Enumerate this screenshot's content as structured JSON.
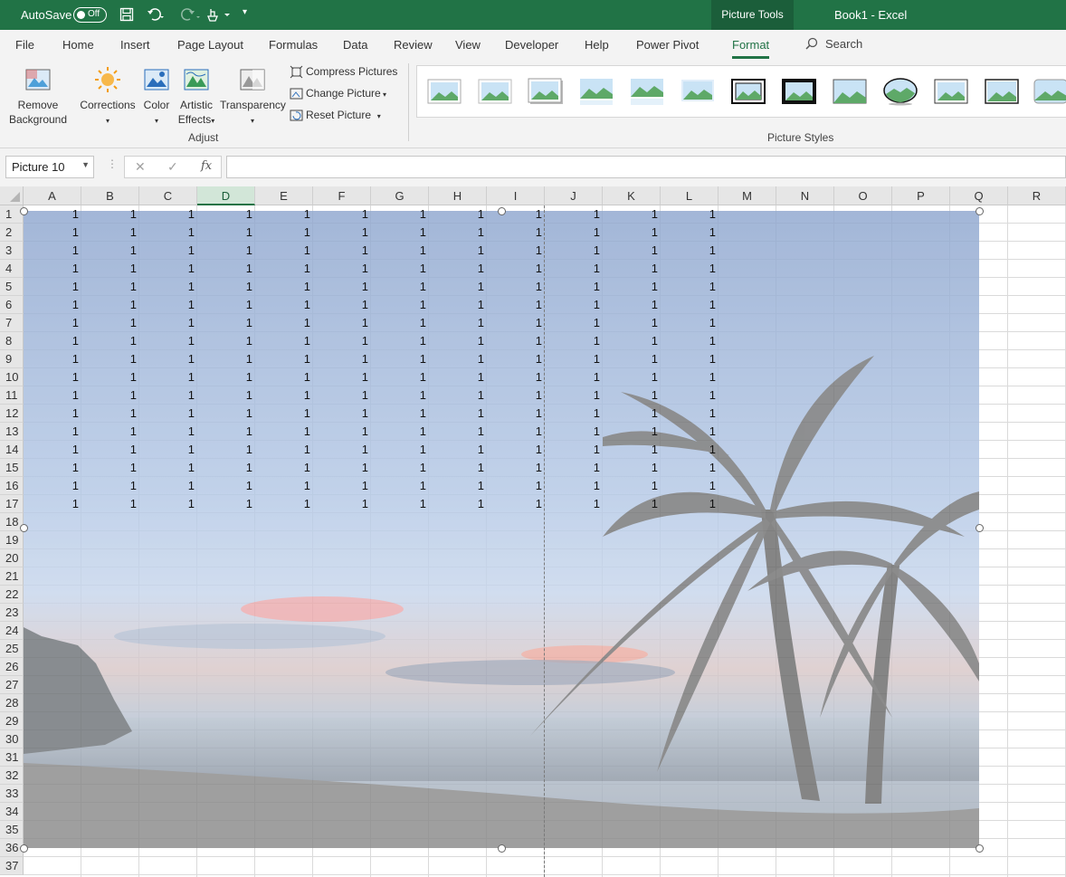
{
  "titlebar": {
    "autosave_label": "AutoSave",
    "autosave_state": "Off",
    "context_tab": "Picture Tools",
    "doc_title": "Book1  -  Excel"
  },
  "tabs": [
    "File",
    "Home",
    "Insert",
    "Page Layout",
    "Formulas",
    "Data",
    "Review",
    "View",
    "Developer",
    "Help",
    "Power Pivot",
    "Format"
  ],
  "active_tab": "Format",
  "search_label": "Search",
  "ribbon": {
    "remove_bg": [
      "Remove",
      "Background"
    ],
    "corrections": "Corrections",
    "color": "Color",
    "artistic": [
      "Artistic",
      "Effects"
    ],
    "transparency": "Transparency",
    "compress": "Compress Pictures",
    "change": "Change Picture",
    "reset": "Reset Picture",
    "adjust_group": "Adjust",
    "styles_group": "Picture Styles"
  },
  "formula_bar": {
    "name_box": "Picture 10",
    "cancel": "✕",
    "enter": "✓",
    "fx": "fx",
    "content": ""
  },
  "grid": {
    "columns": [
      "A",
      "B",
      "C",
      "D",
      "E",
      "F",
      "G",
      "H",
      "I",
      "J",
      "K",
      "L",
      "M",
      "N",
      "O",
      "P",
      "Q",
      "R"
    ],
    "selected_column": "D",
    "rows": [
      1,
      2,
      3,
      4,
      5,
      6,
      7,
      8,
      9,
      10,
      11,
      12,
      13,
      14,
      15,
      16,
      17,
      18,
      19,
      20,
      21,
      22,
      23,
      24,
      25,
      26,
      27,
      28,
      29,
      30,
      31,
      32,
      33,
      34,
      35,
      36,
      37
    ],
    "data_rows": 17,
    "data_cols": 12,
    "cell_value": "1"
  },
  "colors": {
    "excel_green": "#217346",
    "ribbon_bg": "#f3f3f3"
  }
}
